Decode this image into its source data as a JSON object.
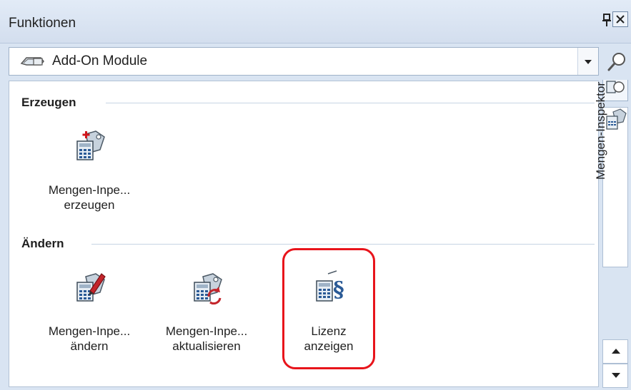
{
  "panel": {
    "title": "Funktionen",
    "pin_glyph": "̄",
    "close_glyph": "✕"
  },
  "module_select": {
    "value": "Add-On Module",
    "icon": "add-on-module-icon"
  },
  "sections": [
    {
      "title": "Erzeugen",
      "tools": [
        {
          "label_line1": "Mengen-Inpe...",
          "label_line2": "erzeugen",
          "icon": "quantity-inspector-create-icon"
        }
      ]
    },
    {
      "title": "Ändern",
      "tools": [
        {
          "label_line1": "Mengen-Inpe...",
          "label_line2": "ändern",
          "icon": "quantity-inspector-edit-icon"
        },
        {
          "label_line1": "Mengen-Inpe...",
          "label_line2": "aktualisieren",
          "icon": "quantity-inspector-update-icon"
        },
        {
          "label_line1": "Lizenz",
          "label_line2": "anzeigen",
          "icon": "license-icon"
        }
      ]
    }
  ],
  "side_panel": {
    "tab_label": "Mengen-Inspektor"
  },
  "colors": {
    "highlight": "#e8141b",
    "frame": "#d9e4f2",
    "accent_blue": "#2a5a96"
  }
}
